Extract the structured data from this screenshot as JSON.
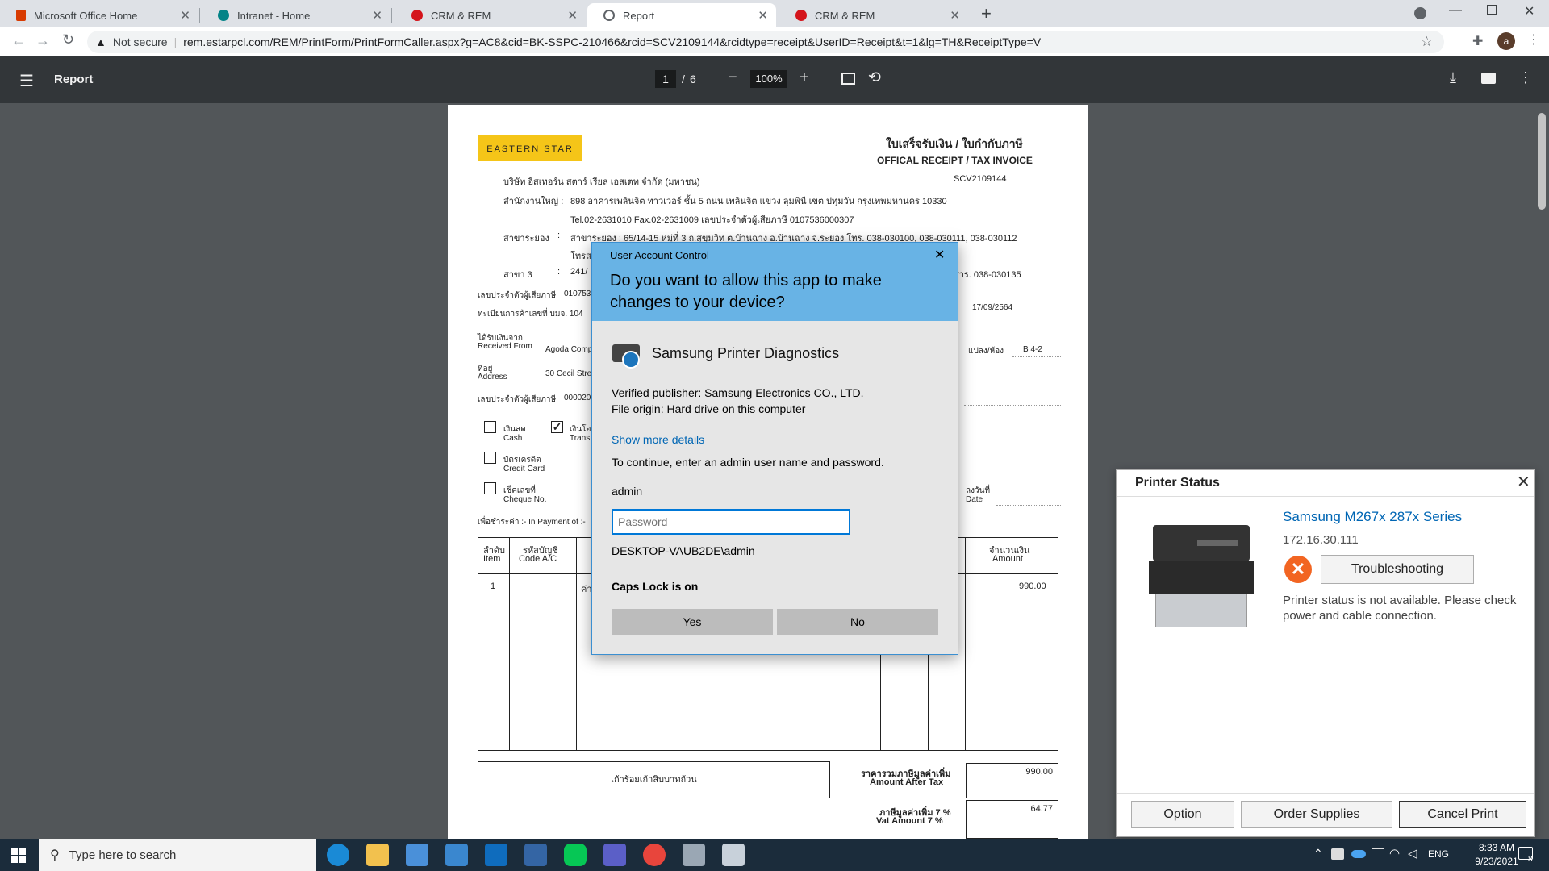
{
  "browser": {
    "tabs": [
      {
        "title": "Microsoft Office Home",
        "favicon": "office-icon"
      },
      {
        "title": "Intranet - Home",
        "favicon": "sharepoint-icon"
      },
      {
        "title": "CRM & REM",
        "favicon": "crm-icon"
      },
      {
        "title": "Report",
        "favicon": "globe-icon"
      },
      {
        "title": "CRM & REM",
        "favicon": "crm-icon"
      }
    ],
    "security_label": "Not secure",
    "url": "rem.estarpcl.com/REM/PrintForm/PrintFormCaller.aspx?g=AC8&cid=BK-SSPC-210466&rcid=SCV2109144&rcidtype=receipt&UserID=Receipt&t=1&lg=TH&ReceiptType=V",
    "profile_initial": "a"
  },
  "pdf_toolbar": {
    "title": "Report",
    "current_page": "1",
    "separator": "/",
    "total_pages": "6",
    "zoom": "100%"
  },
  "receipt": {
    "logo_text": "EASTERN STAR",
    "title_th": "ใบเสร็จรับเงิน / ใบกำกับภาษี",
    "title_en": "OFFICAL RECEIPT / TAX INVOICE",
    "number": "SCV2109144",
    "company_th": "บริษัท อีสเทอร์น สตาร์ เรียล เอสเตท จำกัด (มหาชน)",
    "hq_label": "สำนักงานใหญ่ :",
    "hq_address": "898  อาคารเพลินจิต ทาวเวอร์ ชั้น 5  ถนน เพลินจิต แขวง ลุมพินี เขต ปทุมวัน กรุงเทพมหานคร  10330",
    "hq_tel": "Tel.02-2631010 Fax.02-2631009 เลขประจำตัวผู้เสียภาษี 0107536000307",
    "rayong_label": "สาขาระยอง",
    "rayong_colon": ":",
    "rayong_address": "สาขาระยอง : 65/14-15 หมู่ที่ 3 ถ.สุขุมวิท ต.บ้านฉาง อ.บ้านฉาง จ.ระยอง โทร. 038-030100, 038-030111, 038-030112",
    "rayong_cont": "โทรส",
    "branch3_label": "สาขา 3",
    "branch3_colon": ":",
    "branch3_start": "241/",
    "branch3_end": "สาร. 038-030135",
    "taxid_label": "เลขประจำตัวผู้เสียภาษี",
    "taxid_partial": "010753",
    "date": "17/09/2564",
    "reg_label": "ทะเบียนการค้าเลขที่ บมจ. 104",
    "received_th": "ได้รับเงินจาก",
    "received_en": "Received From",
    "received_value": "Agoda Comp",
    "unit_label": "แปลง/ห้อง",
    "unit_value": "B 4-2",
    "address_th": "ที่อยู่",
    "address_en": "Address",
    "address_value": "30 Cecil Stre",
    "taxid2_label": "เลขประจำตัวผู้เสียภาษี",
    "taxid2_value": "000020",
    "pay_cash_th": "เงินสด",
    "pay_cash_en": "Cash",
    "pay_transfer_th": "เงินโอ",
    "pay_transfer_en": "Trans",
    "pay_card_th": "บัตรเครดิต",
    "pay_card_en": "Credit Card",
    "pay_cheque_th": "เช็คเลขที่",
    "pay_cheque_en": "Cheque No.",
    "dated_th": "ลงวันที่",
    "dated_en": "Date",
    "payment_for": "เพื่อชำระค่า :- In Payment of :-",
    "col_item_th": "ลำดับ",
    "col_item_en": "Item",
    "col_code_th": "รหัสบัญชี",
    "col_code_en": "Code A/C",
    "col_amount_th": "จำนวนเงิน",
    "col_amount_en": "Amount",
    "row1_item": "1",
    "row1_desc": "ค่า",
    "row1_amount": "990.00",
    "amount_words": "เก้าร้อยเก้าสิบบาทถ้วน",
    "after_tax_th": "ราคารวมภาษีมูลค่าเพิ่ม",
    "after_tax_en": "Amount After Tax",
    "after_tax_value": "990.00",
    "vat_th": "ภาษีมูลค่าเพิ่ม 7 %",
    "vat_en": "Vat Amount 7 %",
    "vat_value": "64.77"
  },
  "uac": {
    "window_title": "User Account Control",
    "question": "Do you want to allow this app to make changes to your device?",
    "app_name": "Samsung Printer Diagnostics",
    "publisher": "Verified publisher: Samsung Electronics CO., LTD.",
    "origin": "File origin: Hard drive on this computer",
    "more_details": "Show more details",
    "instruction": "To continue, enter an admin user name and password.",
    "username": "admin",
    "password_placeholder": "Password",
    "domain_user": "DESKTOP-VAUB2DE\\admin",
    "caps_warning": "Caps Lock is on",
    "yes": "Yes",
    "no": "No"
  },
  "printer_status": {
    "title": "Printer Status",
    "printer_name": "Samsung M267x 287x Series",
    "ip": "172.16.30.111",
    "troubleshoot": "Troubleshooting",
    "message": "Printer status is not available. Please check power and cable connection.",
    "option": "Option",
    "order": "Order Supplies",
    "cancel": "Cancel Print"
  },
  "taskbar": {
    "search_placeholder": "Type here to search",
    "lang": "ENG",
    "time": "8:33 AM",
    "date": "9/23/2021",
    "notifications": "8"
  },
  "colors": {
    "uac_header": "#68b3e5",
    "logo_bg": "#f5c518",
    "link": "#0066b4",
    "pdf_toolbar": "#323639",
    "taskbar": "#1b2c3b"
  }
}
